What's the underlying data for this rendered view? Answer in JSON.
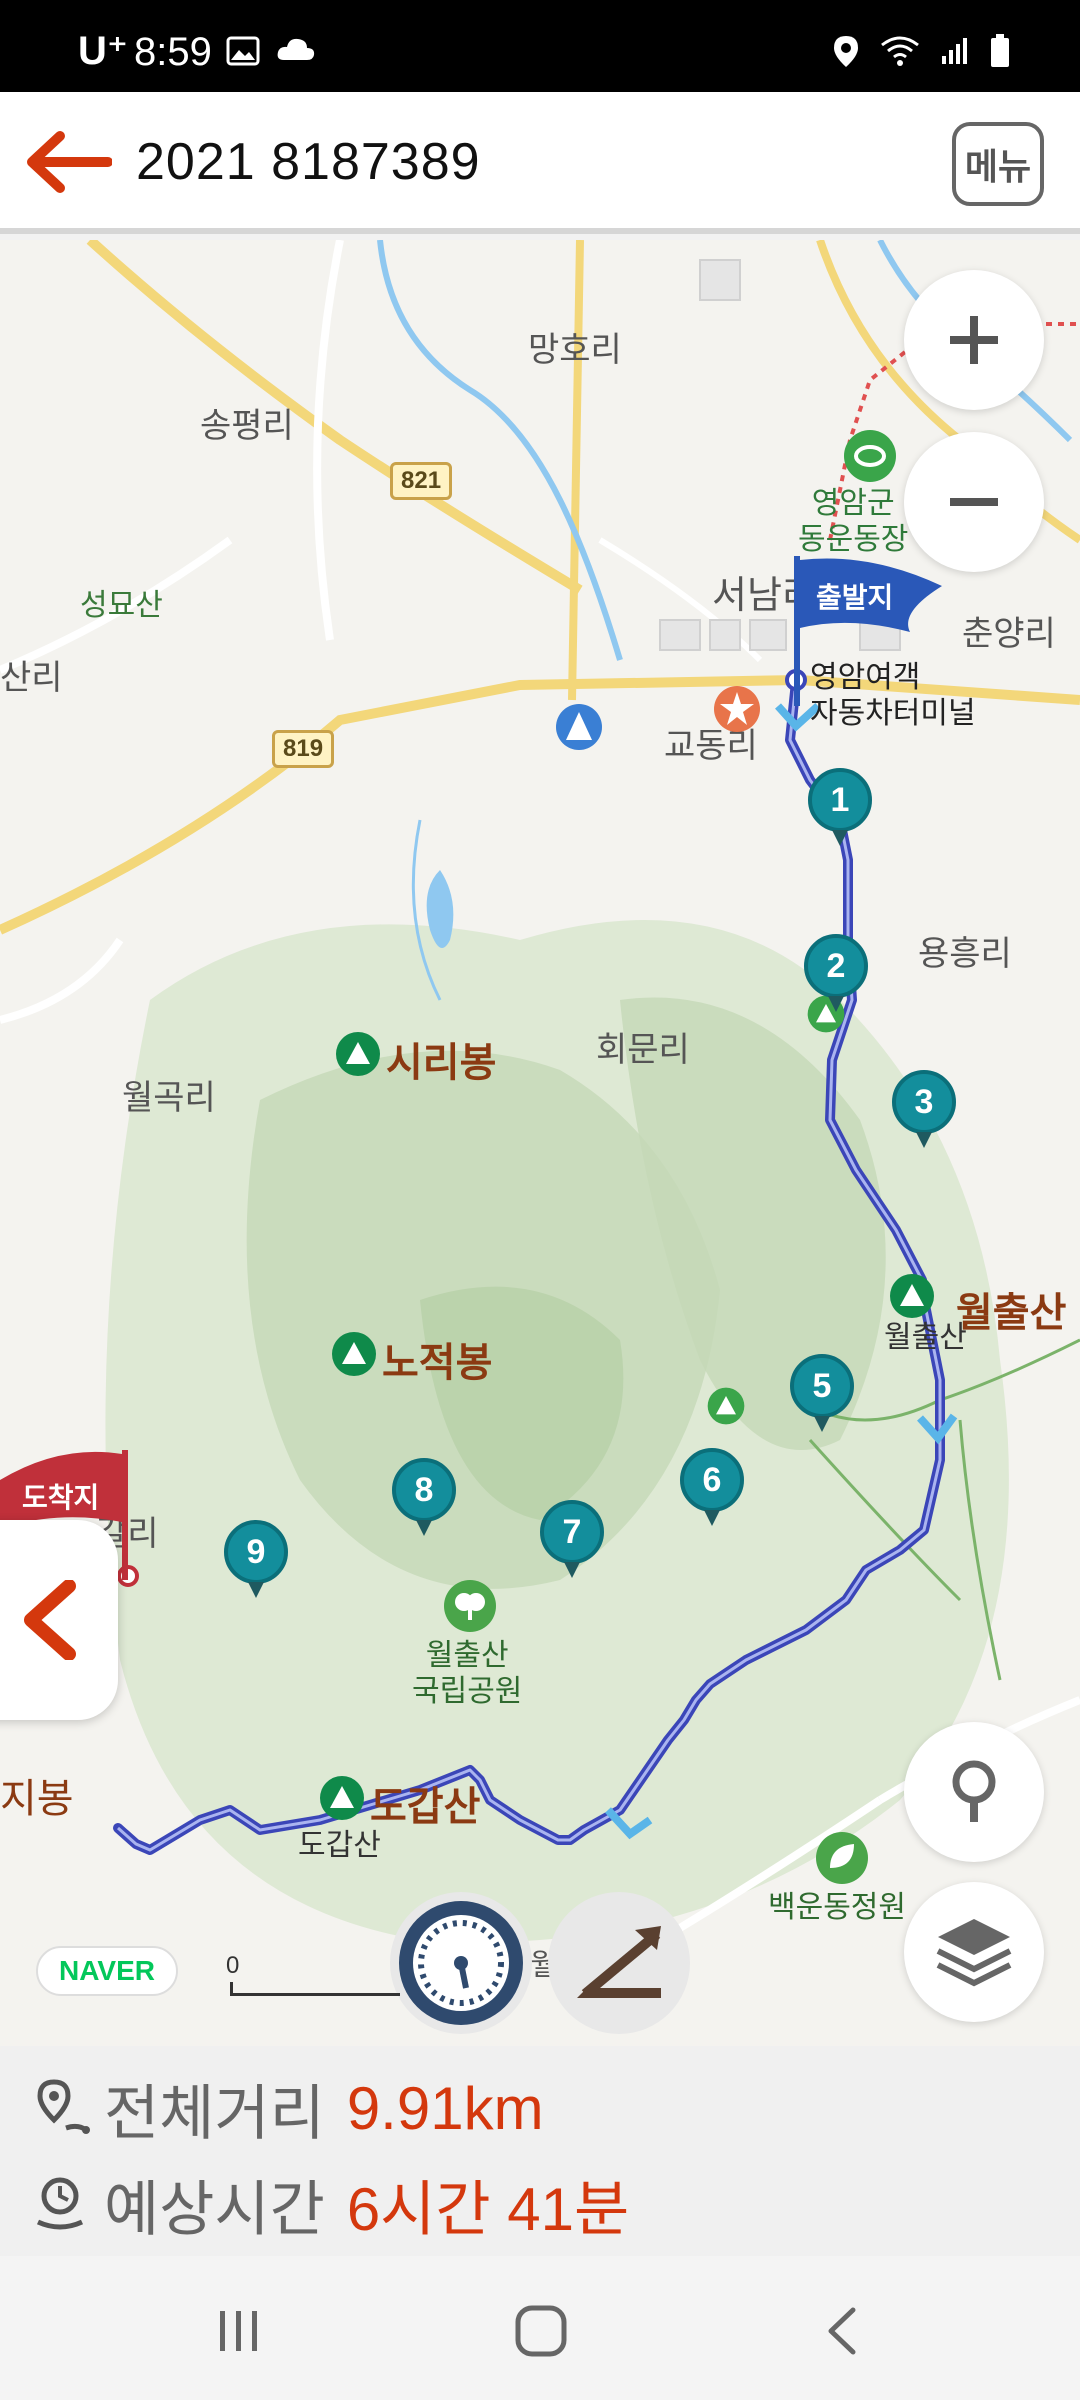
{
  "status_bar": {
    "carrier": "U⁺",
    "time": "8:59",
    "left_icons": [
      "image-icon",
      "cloud-icon"
    ],
    "right_icons": [
      "location-icon",
      "wifi-icon",
      "signal-icon",
      "battery-icon"
    ]
  },
  "header": {
    "title": "2021 8187389",
    "menu_label": "메뉴"
  },
  "map": {
    "places": {
      "manghori": "망호리",
      "songpyeongri": "송평리",
      "seongmyosan": "성묘산",
      "sanri": "산리",
      "seonamri": "서남리",
      "gyodongri": "교동리",
      "yongheungri": "용흥리",
      "chunyangri": "춘양리",
      "hoemunri": "회문리",
      "wolgokri": "월곡리",
      "sanri_partial": "갈리",
      "ji_bong": "지봉",
      "wol_partial": "월"
    },
    "pois": {
      "yeongam_stadium": "영암군\n동운동장",
      "yeongam_terminal": "영암여객\n자동차터미널",
      "wolchulsan_park": "월출산\n국립공원",
      "baekun_garden": "백운동정원",
      "wolchulsan_small": "월출산",
      "dogapsan_small": "도갑산"
    },
    "mountains": {
      "siribong": "시리봉",
      "nojeokbong": "노적봉",
      "wolchulsan": "월출산",
      "dogapsan": "도갑산"
    },
    "road_numbers": [
      "821",
      "819"
    ],
    "start_flag": "출발지",
    "end_flag": "도착지",
    "waypoints": [
      "1",
      "2",
      "3",
      "5",
      "6",
      "7",
      "8",
      "9"
    ],
    "scale_label": "0",
    "brand": "NAVER"
  },
  "info": {
    "distance_label": "전체거리",
    "distance_value": "9.91km",
    "time_label": "예상시간",
    "time_value": "6시간 41분"
  },
  "colors": {
    "accent": "#d4380d",
    "route": "#3b46b8",
    "marker": "#138e9c",
    "start_flag": "#2a58b8",
    "end_flag": "#c0303a"
  }
}
